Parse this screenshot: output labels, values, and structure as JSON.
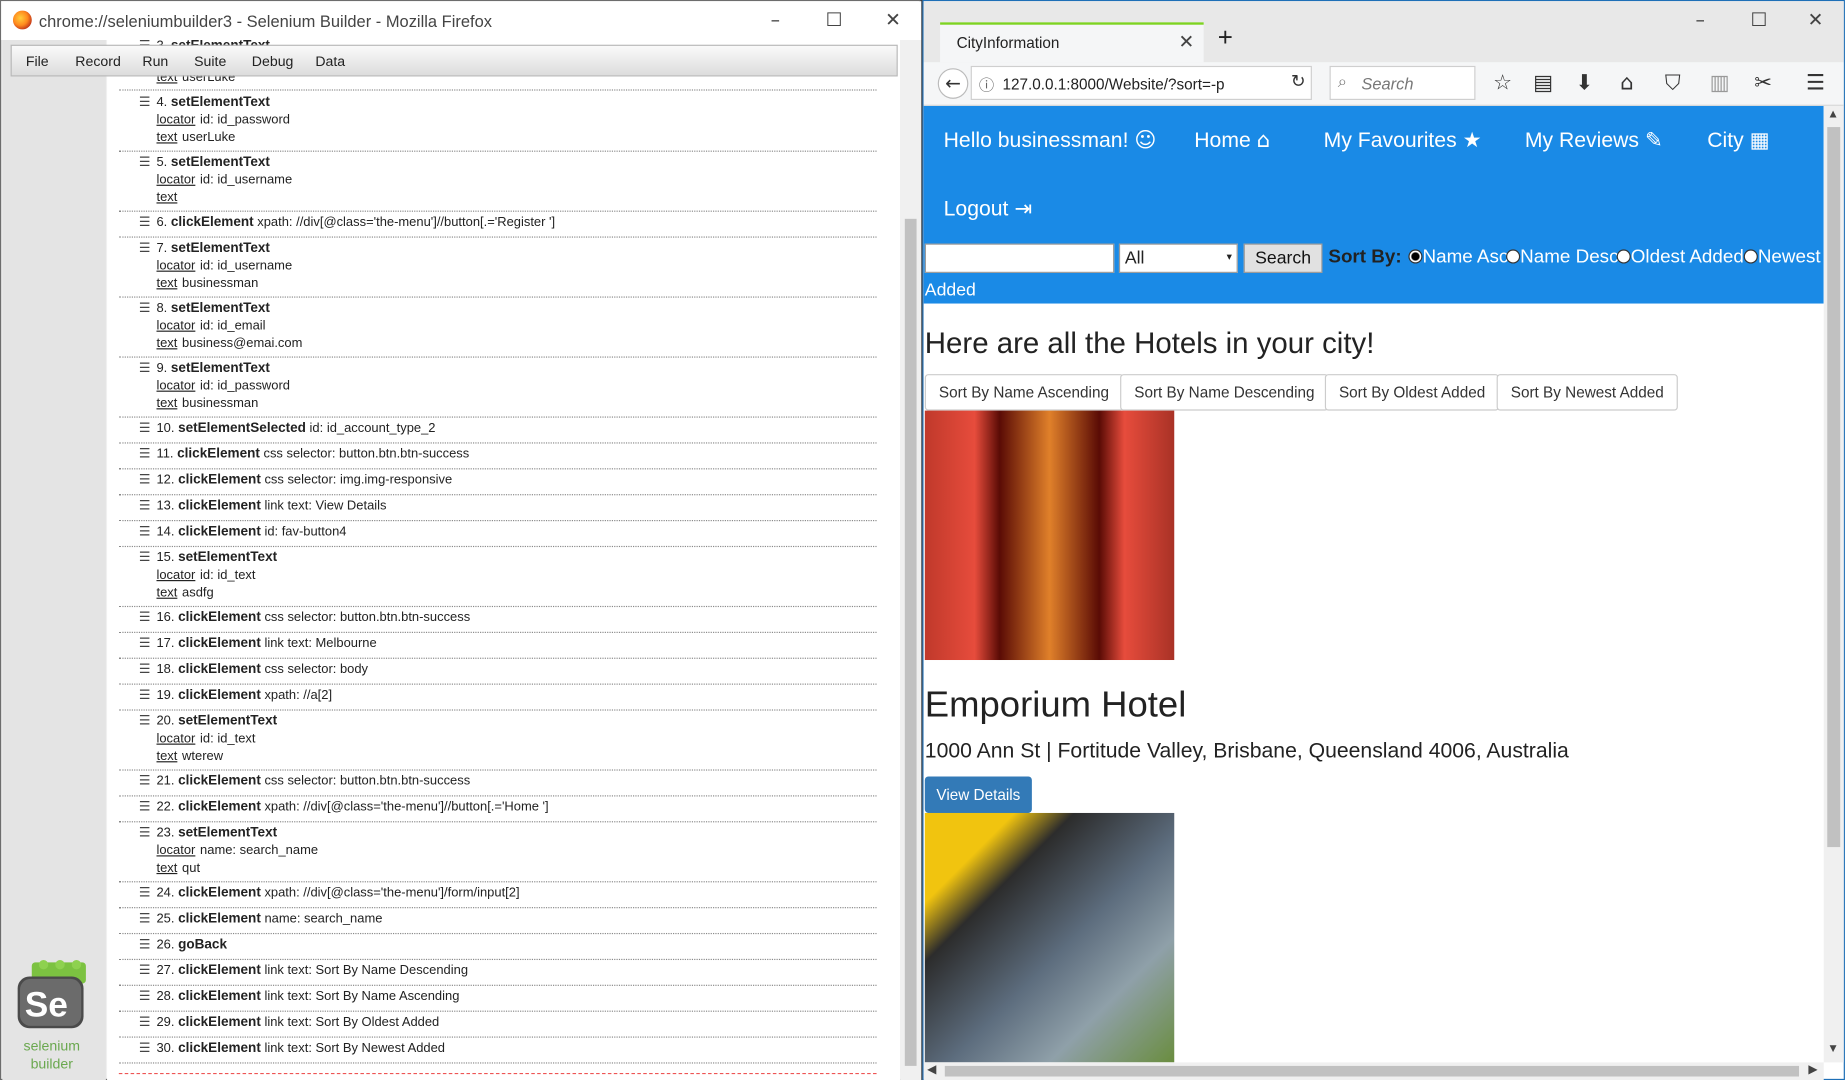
{
  "builder": {
    "title": "chrome://seleniumbuilder3 - Selenium Builder - Mozilla Firefox",
    "menu": [
      "File",
      "Record",
      "Run",
      "Suite",
      "Debug",
      "Data"
    ],
    "logo_text": "Se",
    "logo_label_1": "selenium",
    "logo_label_2": "builder",
    "partial_top": {
      "num": "3.",
      "cmd": "setElementText",
      "sub_key": "text",
      "sub_val": "userLuke"
    },
    "steps": [
      {
        "num": "4.",
        "cmd": "setElementText",
        "arg": "",
        "sub": [
          {
            "k": "locator",
            "v": "id: id_password"
          },
          {
            "k": "text",
            "v": "userLuke"
          }
        ]
      },
      {
        "num": "5.",
        "cmd": "setElementText",
        "arg": "",
        "sub": [
          {
            "k": "locator",
            "v": "id: id_username"
          },
          {
            "k": "text",
            "v": ""
          }
        ]
      },
      {
        "num": "6.",
        "cmd": "clickElement",
        "arg": "xpath: //div[@class='the-menu']//button[.='Register ']",
        "sub": []
      },
      {
        "num": "7.",
        "cmd": "setElementText",
        "arg": "",
        "sub": [
          {
            "k": "locator",
            "v": "id: id_username"
          },
          {
            "k": "text",
            "v": "businessman"
          }
        ]
      },
      {
        "num": "8.",
        "cmd": "setElementText",
        "arg": "",
        "sub": [
          {
            "k": "locator",
            "v": "id: id_email"
          },
          {
            "k": "text",
            "v": "business@emai.com"
          }
        ]
      },
      {
        "num": "9.",
        "cmd": "setElementText",
        "arg": "",
        "sub": [
          {
            "k": "locator",
            "v": "id: id_password"
          },
          {
            "k": "text",
            "v": "businessman"
          }
        ]
      },
      {
        "num": "10.",
        "cmd": "setElementSelected",
        "arg": "id: id_account_type_2",
        "sub": []
      },
      {
        "num": "11.",
        "cmd": "clickElement",
        "arg": "css selector: button.btn.btn-success",
        "sub": []
      },
      {
        "num": "12.",
        "cmd": "clickElement",
        "arg": "css selector: img.img-responsive",
        "sub": []
      },
      {
        "num": "13.",
        "cmd": "clickElement",
        "arg": "link text: View Details",
        "sub": []
      },
      {
        "num": "14.",
        "cmd": "clickElement",
        "arg": "id: fav-button4",
        "sub": []
      },
      {
        "num": "15.",
        "cmd": "setElementText",
        "arg": "",
        "sub": [
          {
            "k": "locator",
            "v": "id: id_text"
          },
          {
            "k": "text",
            "v": "asdfg"
          }
        ]
      },
      {
        "num": "16.",
        "cmd": "clickElement",
        "arg": "css selector: button.btn.btn-success",
        "sub": []
      },
      {
        "num": "17.",
        "cmd": "clickElement",
        "arg": "link text: Melbourne",
        "sub": []
      },
      {
        "num": "18.",
        "cmd": "clickElement",
        "arg": "css selector: body",
        "sub": []
      },
      {
        "num": "19.",
        "cmd": "clickElement",
        "arg": "xpath: //a[2]",
        "sub": []
      },
      {
        "num": "20.",
        "cmd": "setElementText",
        "arg": "",
        "sub": [
          {
            "k": "locator",
            "v": "id: id_text"
          },
          {
            "k": "text",
            "v": "wterew"
          }
        ]
      },
      {
        "num": "21.",
        "cmd": "clickElement",
        "arg": "css selector: button.btn.btn-success",
        "sub": []
      },
      {
        "num": "22.",
        "cmd": "clickElement",
        "arg": "xpath: //div[@class='the-menu']//button[.='Home ']",
        "sub": []
      },
      {
        "num": "23.",
        "cmd": "setElementText",
        "arg": "",
        "sub": [
          {
            "k": "locator",
            "v": "name: search_name"
          },
          {
            "k": "text",
            "v": "qut"
          }
        ]
      },
      {
        "num": "24.",
        "cmd": "clickElement",
        "arg": "xpath: //div[@class='the-menu']/form/input[2]",
        "sub": []
      },
      {
        "num": "25.",
        "cmd": "clickElement",
        "arg": "name: search_name",
        "sub": []
      },
      {
        "num": "26.",
        "cmd": "goBack",
        "arg": "",
        "sub": []
      },
      {
        "num": "27.",
        "cmd": "clickElement",
        "arg": "link text: Sort By Name Descending",
        "sub": []
      },
      {
        "num": "28.",
        "cmd": "clickElement",
        "arg": "link text: Sort By Name Ascending",
        "sub": []
      },
      {
        "num": "29.",
        "cmd": "clickElement",
        "arg": "link text: Sort By Oldest Added",
        "sub": []
      },
      {
        "num": "30.",
        "cmd": "clickElement",
        "arg": "link text: Sort By Newest Added",
        "sub": []
      }
    ]
  },
  "browser": {
    "tab_title": "CityInformation",
    "url": "127.0.0.1:8000/Website/?sort=-p",
    "search_placeholder": "Search",
    "accent": "#1a8ae6"
  },
  "site": {
    "nav": [
      {
        "label": "Hello businessman!",
        "icon": "☺",
        "icon_name": "smiley-icon"
      },
      {
        "label": "Home",
        "icon": "⌂",
        "icon_name": "home-icon"
      },
      {
        "label": "My Favourites",
        "icon": "★",
        "icon_name": "star-icon"
      },
      {
        "label": "My Reviews",
        "icon": "✎",
        "icon_name": "pencil-icon"
      },
      {
        "label": "City",
        "icon": "▦",
        "icon_name": "building-icon"
      },
      {
        "label": "Logout",
        "icon": "⇥",
        "icon_name": "logout-icon"
      }
    ],
    "search_select": "All",
    "search_button": "Search",
    "sort_by_label": "Sort By:",
    "radios": [
      "Name Asc",
      "Name Desc",
      "Oldest Added",
      "Newest"
    ],
    "radio_wrap": "Added",
    "heading": "Here are all the Hotels in your city!",
    "sort_buttons": [
      "Sort By Name Ascending",
      "Sort By Name Descending",
      "Sort By Oldest Added",
      "Sort By Newest Added"
    ],
    "hotel_name": "Emporium Hotel",
    "hotel_address": "1000 Ann St | Fortitude Valley, Brisbane, Queensland 4006, Australia",
    "view_details": "View Details"
  }
}
